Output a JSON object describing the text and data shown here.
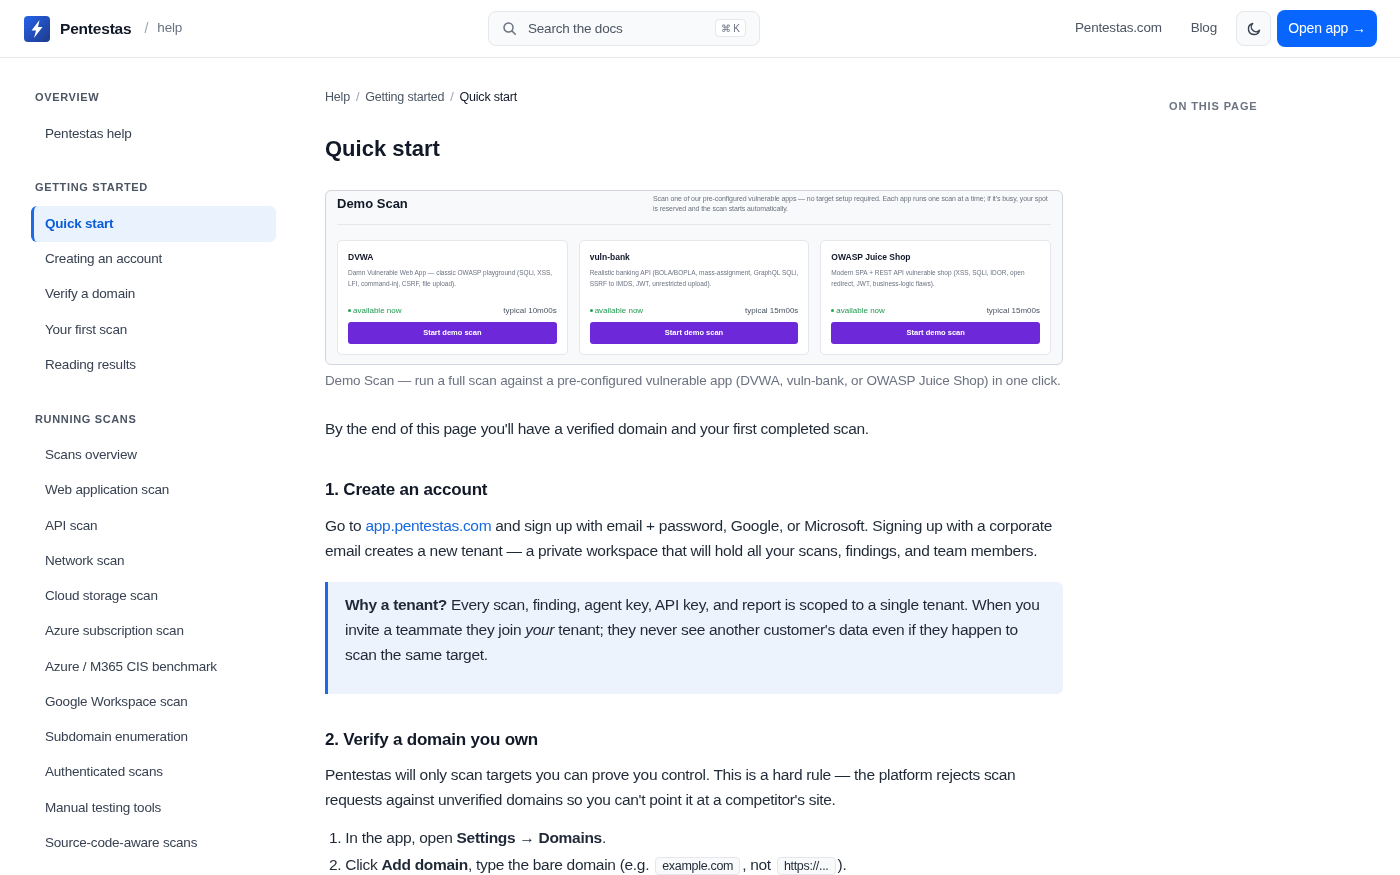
{
  "header": {
    "brand": "Pentestas",
    "separator": "/",
    "section": "help",
    "search": {
      "placeholder": "Search the docs",
      "shortcut": "⌘ K"
    },
    "nav_links": [
      "Pentestas.com",
      "Blog"
    ],
    "open_app_button": "Open app →"
  },
  "sidebar": [
    {
      "heading": "OVERVIEW",
      "items": [
        {
          "label": "Pentestas help",
          "selected": false
        }
      ]
    },
    {
      "heading": "GETTING STARTED",
      "items": [
        {
          "label": "Quick start",
          "selected": true
        },
        {
          "label": "Creating an account",
          "selected": false
        },
        {
          "label": "Verify a domain",
          "selected": false
        },
        {
          "label": "Your first scan",
          "selected": false
        },
        {
          "label": "Reading results",
          "selected": false
        }
      ]
    },
    {
      "heading": "RUNNING SCANS",
      "items": [
        {
          "label": "Scans overview",
          "selected": false
        },
        {
          "label": "Web application scan",
          "selected": false
        },
        {
          "label": "API scan",
          "selected": false
        },
        {
          "label": "Network scan",
          "selected": false
        },
        {
          "label": "Cloud storage scan",
          "selected": false
        },
        {
          "label": "Azure subscription scan",
          "selected": false
        },
        {
          "label": "Azure / M365 CIS benchmark",
          "selected": false
        },
        {
          "label": "Google Workspace scan",
          "selected": false
        },
        {
          "label": "Subdomain enumeration",
          "selected": false
        },
        {
          "label": "Authenticated scans",
          "selected": false
        },
        {
          "label": "Manual testing tools",
          "selected": false
        },
        {
          "label": "Source-code-aware scans",
          "selected": false
        }
      ]
    }
  ],
  "breadcrumb": [
    {
      "kind": "link",
      "text": "Help"
    },
    {
      "kind": "separator",
      "text": "/"
    },
    {
      "kind": "link",
      "text": "Getting started"
    },
    {
      "kind": "separator",
      "text": "/"
    },
    {
      "kind": "current",
      "text": "Quick start"
    }
  ],
  "page": {
    "title": "Quick start",
    "figure": {
      "title": "Demo Scan",
      "description": "Scan one of our pre-configured vulnerable apps — no target setup required. Each app runs one scan at a time; if it's busy, your spot is reserved and the scan starts automatically.",
      "apps": [
        {
          "name": "DVWA",
          "description": "Damn Vulnerable Web App — classic OWASP playground (SQLi, XSS, LFI, command-inj, CSRF, file upload).",
          "status": "available now",
          "duration": "typical 10m00s",
          "button": "Start demo scan"
        },
        {
          "name": "vuln-bank",
          "description": "Realistic banking API (BOLA/BOPLA, mass-assignment, GraphQL SQLi, SSRF to IMDS, JWT, unrestricted upload).",
          "status": "available now",
          "duration": "typical 15m00s",
          "button": "Start demo scan"
        },
        {
          "name": "OWASP Juice Shop",
          "description": "Modern SPA + REST API vulnerable shop (XSS, SQLi, IDOR, open redirect, JWT, business-logic flaws).",
          "status": "available now",
          "duration": "typical 15m00s",
          "button": "Start demo scan"
        }
      ]
    },
    "caption": "Demo Scan — run a full scan against a pre-configured vulnerable app (DVWA, vuln-bank, or OWASP Juice Shop) in one click.",
    "blocks": [
      {
        "kind": "paragraph",
        "segments": [
          {
            "kind": "text",
            "text": "By the end of this page you'll have a verified domain and your first completed scan."
          }
        ]
      },
      {
        "kind": "heading",
        "text": "1. Create an account"
      },
      {
        "kind": "paragraph",
        "segments": [
          {
            "kind": "text",
            "text": "Go to "
          },
          {
            "kind": "link",
            "text": "app.pentestas.com"
          },
          {
            "kind": "text",
            "text": " and sign up with email + password, Google, or Microsoft. Signing up with a corporate email creates a new tenant — a private workspace that will hold all your scans, findings, and team members."
          }
        ]
      },
      {
        "kind": "callout",
        "text": "**Why a tenant?** Every scan, finding, agent key, API key, and report is scoped to a single tenant. When you invite a teammate they join *your* tenant; they never see another customer's data even if they happen to scan the same target."
      },
      {
        "kind": "heading",
        "text": "2. Verify a domain you own"
      },
      {
        "kind": "paragraph",
        "segments": [
          {
            "kind": "text",
            "text": "Pentestas will only scan targets you can prove you control. This is a hard rule — the platform rejects scan requests against unverified domains so you can't point it at a competitor's site."
          }
        ]
      },
      {
        "kind": "ordered_list",
        "items": [
          {
            "number": "1.",
            "segments": [
              {
                "kind": "text",
                "text": "In the app, open **Settings → Domains**."
              }
            ]
          },
          {
            "number": "2.",
            "segments": [
              {
                "kind": "text",
                "text": "Click **Add domain**, type the bare domain (e.g. "
              },
              {
                "kind": "code",
                "text": "example.com"
              },
              {
                "kind": "text",
                "text": ", not "
              },
              {
                "kind": "code",
                "text": "https://..."
              },
              {
                "kind": "text",
                "text": ")."
              }
            ]
          }
        ]
      }
    ]
  },
  "toc": {
    "heading": "ON THIS PAGE"
  }
}
